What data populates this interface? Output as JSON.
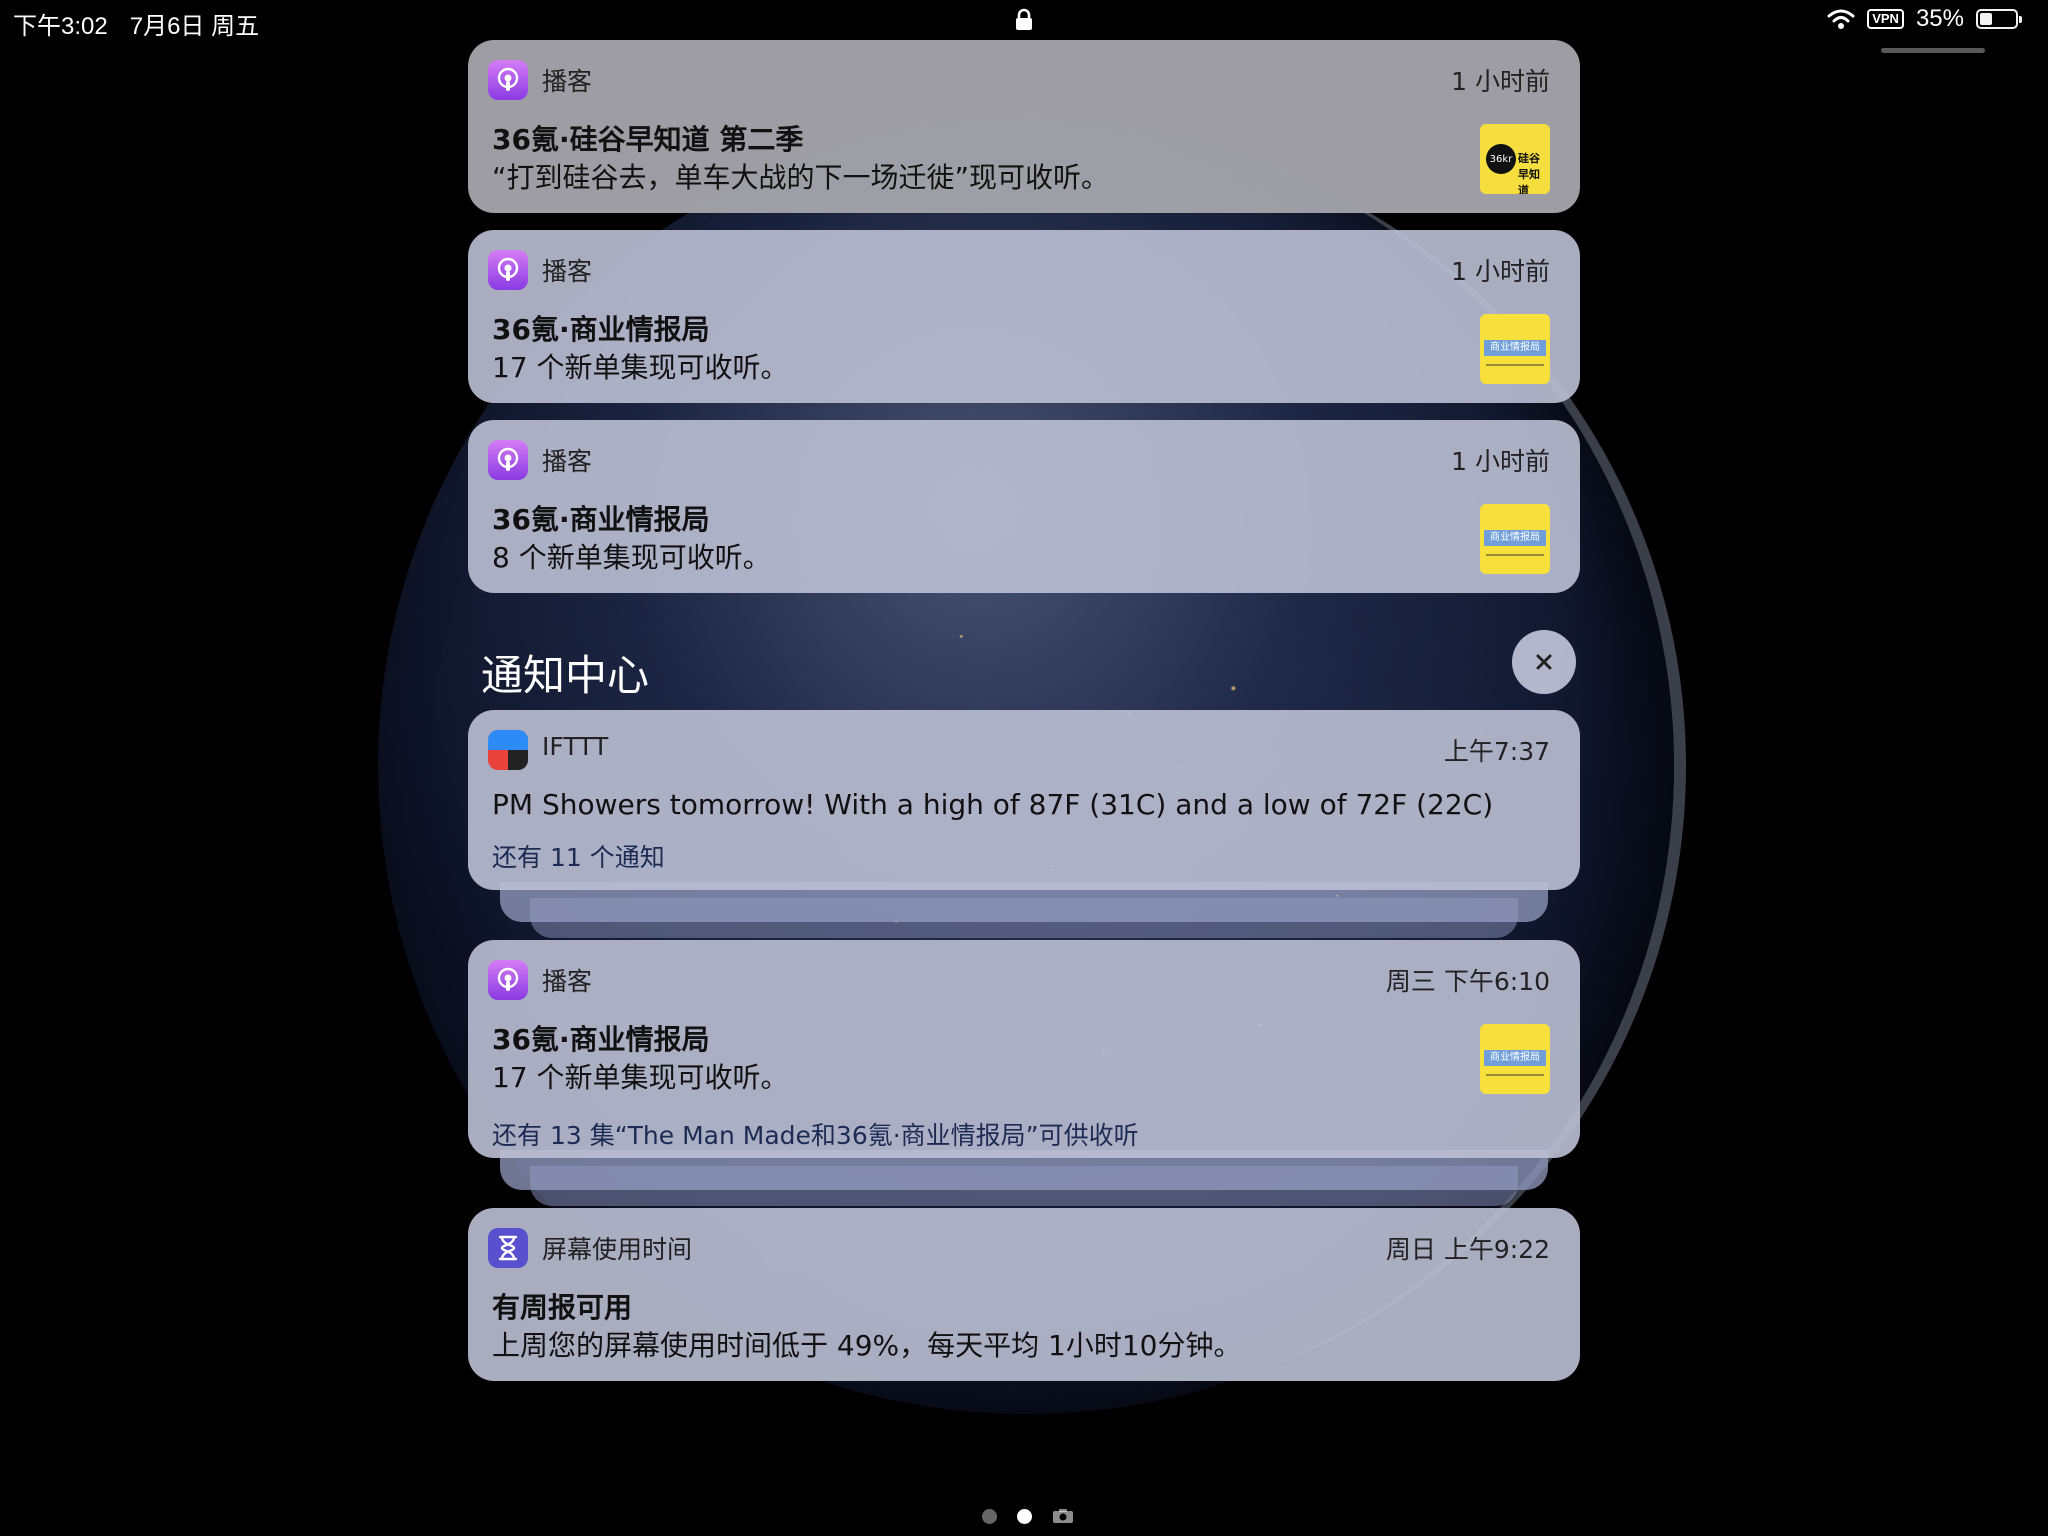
{
  "status_bar": {
    "time": "下午3:02",
    "date": "7月6日 周五",
    "vpn": "VPN",
    "battery": "35%",
    "battery_level": 0.35
  },
  "notifications_top": [
    {
      "app": "播客",
      "time": "1 小时前",
      "title": "36氪·硅谷早知道 第二季",
      "body": "“打到硅谷去，单车大战的下一场迁徙”现可收听。",
      "thumb_text": "硅谷早知道"
    },
    {
      "app": "播客",
      "time": "1 小时前",
      "title": "36氪·商业情报局",
      "body": "17 个新单集现可收听。",
      "thumb_text": "商业情报局"
    },
    {
      "app": "播客",
      "time": "1 小时前",
      "title": "36氪·商业情报局",
      "body": "8 个新单集现可收听。",
      "thumb_text": "商业情报局"
    }
  ],
  "notification_center": {
    "title": "通知中心",
    "close_icon": "close-icon"
  },
  "ifttt": {
    "app": "IFTTT",
    "time": "上午7:37",
    "body": "PM Showers tomorrow! With a high of 87F (31C) and a low of 72F (22C)",
    "more": "还有 11 个通知"
  },
  "podcast_group": {
    "app": "播客",
    "time": "周三 下午6:10",
    "title": "36氪·商业情报局",
    "body": "17 个新单集现可收听。",
    "more": "还有 13 集“The Man Made和36氪·商业情报局”可供收听",
    "thumb_text": "商业情报局"
  },
  "screentime": {
    "app": "屏幕使用时间",
    "time": "周日 上午9:22",
    "title": "有周报可用",
    "body": "上周您的屏幕使用时间低于 49%，每天平均 1小时10分钟。"
  },
  "colors": {
    "podcast": "#9b4ce6",
    "screentime": "#5a4fcf",
    "ifttt_blue": "#2d8bf7",
    "ifttt_red": "#e9413c"
  }
}
